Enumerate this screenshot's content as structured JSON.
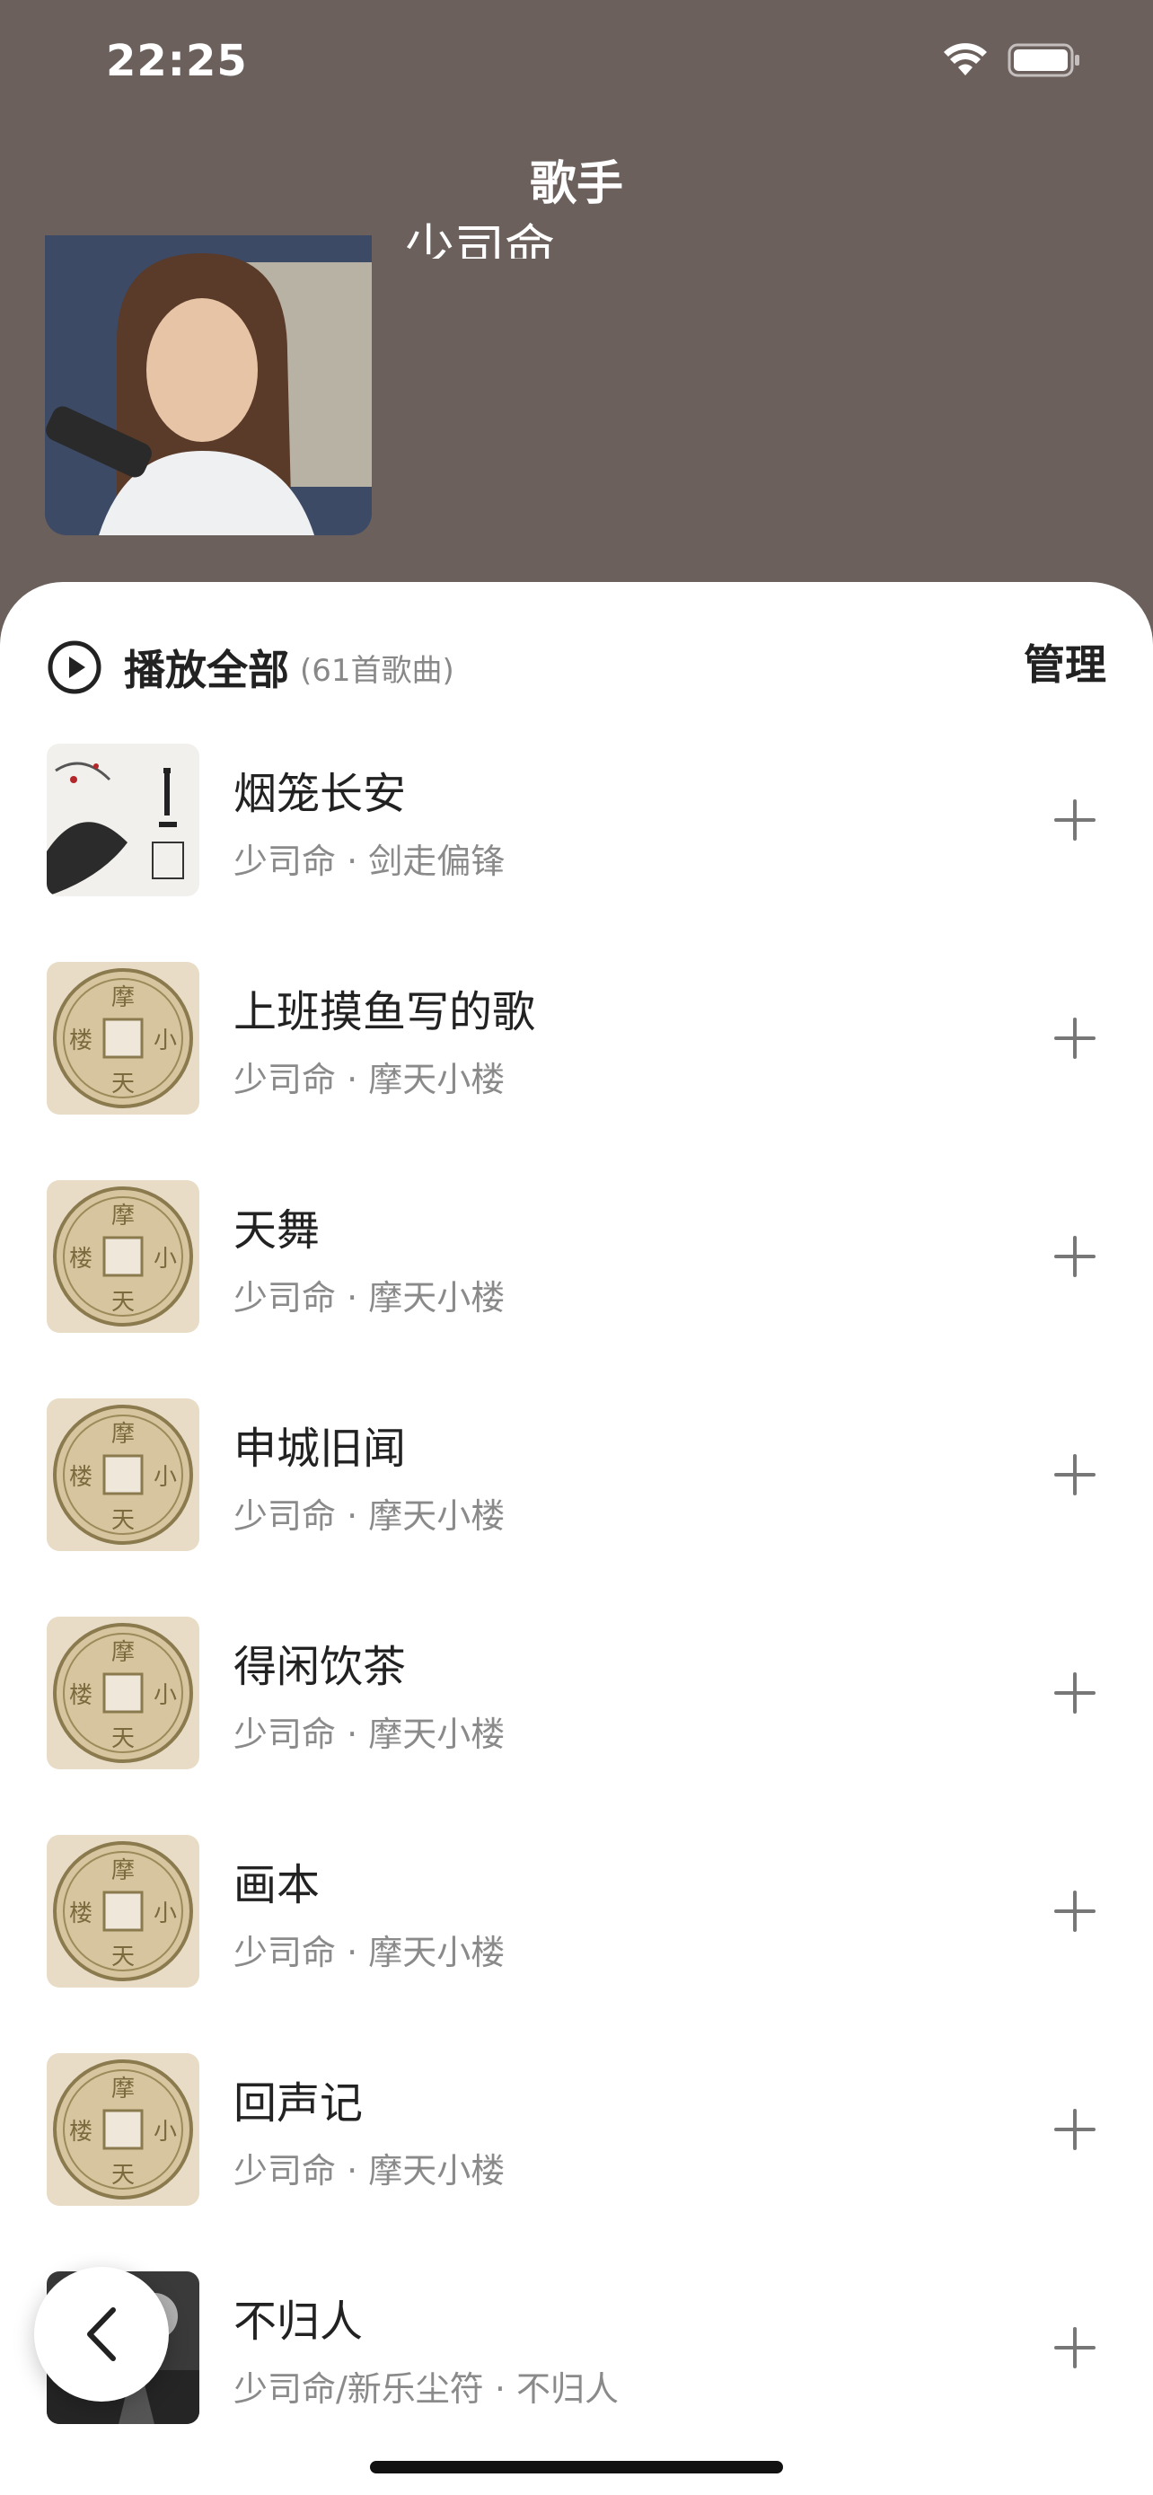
{
  "status_bar": {
    "time": "22:25"
  },
  "nav": {
    "title": "歌手"
  },
  "artist": {
    "name": "少司命"
  },
  "list_header": {
    "play_all_label": "播放全部",
    "song_count": "(61首歌曲)",
    "manage_label": "管理"
  },
  "songs": [
    {
      "title": "烟笼长安",
      "subtitle": "少司命 · 剑走偏锋",
      "cover": "ink-painting"
    },
    {
      "title": "上班摸鱼写的歌",
      "subtitle": "少司命 · 摩天小楼",
      "cover": "coin"
    },
    {
      "title": "天舞",
      "subtitle": "少司命 · 摩天小楼",
      "cover": "coin"
    },
    {
      "title": "申城旧闻",
      "subtitle": "少司命 · 摩天小楼",
      "cover": "coin"
    },
    {
      "title": "得闲饮茶",
      "subtitle": "少司命 · 摩天小楼",
      "cover": "coin"
    },
    {
      "title": "画本",
      "subtitle": "少司命 · 摩天小楼",
      "cover": "coin"
    },
    {
      "title": "回声记",
      "subtitle": "少司命 · 摩天小楼",
      "cover": "coin"
    },
    {
      "title": "不归人",
      "subtitle": "少司命/新乐尘符 · 不归人",
      "cover": "dark-photo"
    }
  ],
  "colors": {
    "header_bg": "#6b605c",
    "sheet_bg": "#ffffff",
    "text_primary": "#222222",
    "text_secondary": "#8a8a8a"
  }
}
